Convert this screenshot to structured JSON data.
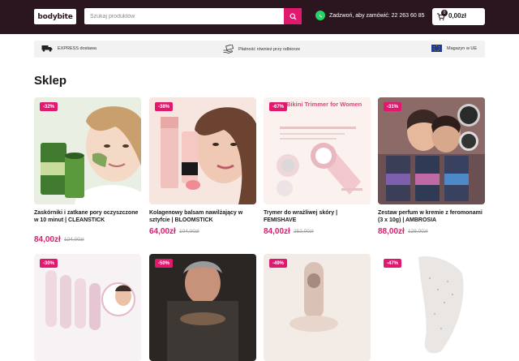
{
  "header": {
    "logo_text": "bodybite",
    "search_placeholder": "Szukaj produktów",
    "phone_text": "Zadzwoń, aby zamówić: 22 263 60 85",
    "cart_count": "0",
    "cart_total": "0,00zł",
    "colors": {
      "bar": "#2b1620",
      "accent": "#e0196f",
      "whatsapp": "#25d366"
    }
  },
  "infobar": {
    "delivery": "EXPRESS dostawa",
    "pay_on_delivery": "Płatność również przy odbiorze",
    "warehouse": "Magazyn w UE"
  },
  "shop": {
    "heading": "Sklep",
    "products": [
      {
        "badge": "-32%",
        "title": "Zaskórniki i zatkane pory oczyszczone w 10 minut | CLEANSTICK",
        "price": "84,00zł",
        "old_price": "124,00zł"
      },
      {
        "badge": "-38%",
        "title": "Kolagenowy balsam nawilżający w sztyfcie | BLOOMSTICK",
        "price": "64,00zł",
        "old_price": "104,00zł"
      },
      {
        "badge": "-67%",
        "title": "Trymer do wrażliwej skóry | FEMISHAVE",
        "price": "84,00zł",
        "old_price": "252,00zł",
        "image_text": "Bikini Trimmer for Women"
      },
      {
        "badge": "-31%",
        "title": "Zestaw perfum w kremie z feromonami (3 x 10g) | AMBROSIA",
        "price": "88,00zł",
        "old_price": "128,00zł"
      },
      {
        "badge": "-30%"
      },
      {
        "badge": "-50%"
      },
      {
        "badge": "-49%"
      },
      {
        "badge": "-47%"
      }
    ]
  }
}
